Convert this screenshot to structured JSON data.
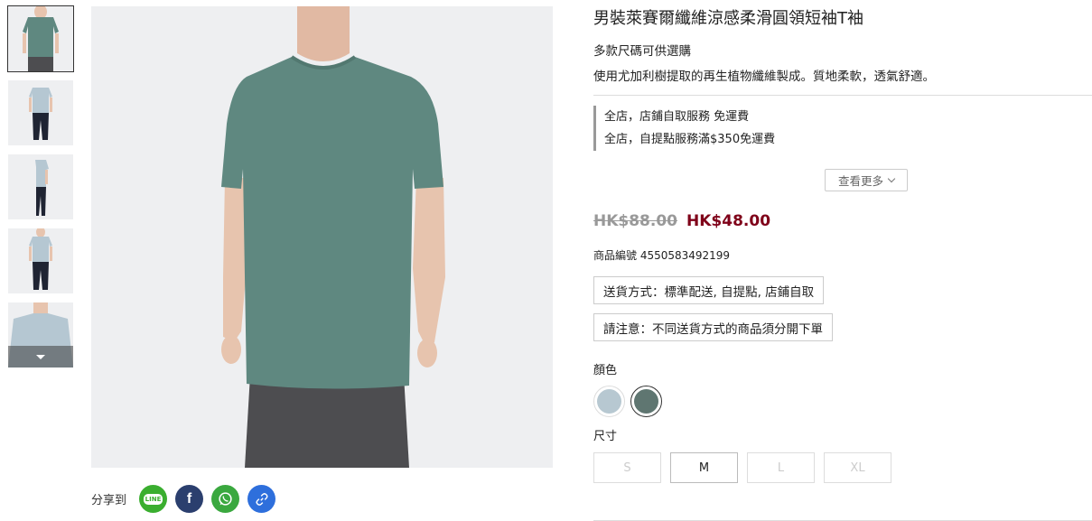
{
  "product": {
    "title": "男裝萊賽爾纖維涼感柔滑圓領短袖T袖",
    "subtitle": "多款尺碼可供選購",
    "description": "使用尤加利樹提取的再生植物纖維製成。質地柔軟，透氣舒適。",
    "promos": [
      "全店，店鋪自取服務 免運費",
      "全店，自提點服務滿$350免運費"
    ],
    "see_more_label": "查看更多",
    "price_original": "HK$88.00",
    "price_sale": "HK$48.00",
    "sku_text": "商品編號 4550583492199",
    "delivery_text": "送貨方式：標準配送, 自提點, 店鋪自取",
    "notice_text": "請注意：不同送貨方式的商品須分開下單",
    "color_label": "顏色",
    "colors": [
      {
        "hex": "#b7c8d1",
        "selected": false
      },
      {
        "hex": "#5f7671",
        "selected": true
      }
    ],
    "size_label": "尺寸",
    "sizes": [
      {
        "label": "S",
        "available": false
      },
      {
        "label": "M",
        "available": true
      },
      {
        "label": "L",
        "available": false
      },
      {
        "label": "XL",
        "available": false
      }
    ]
  },
  "share": {
    "label": "分享到",
    "buttons": [
      {
        "icon": "line-icon",
        "glyph": "LINE",
        "color": "#3aae2f"
      },
      {
        "icon": "facebook-icon",
        "glyph": "f",
        "color": "#2b3f6e"
      },
      {
        "icon": "whatsapp-icon",
        "glyph": "",
        "color": "#3aa83f"
      },
      {
        "icon": "link-icon",
        "glyph": "",
        "color": "#2e6fdc"
      }
    ]
  },
  "colors": {
    "shirt_green": "#5f8880",
    "shirt_blue": "#b5c7d2",
    "pants_dark": "#4d4d50",
    "pants_navy": "#1f2433",
    "skin": "#e7c4ae",
    "price_red": "#7f0019"
  }
}
